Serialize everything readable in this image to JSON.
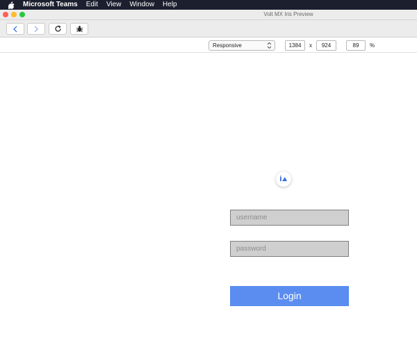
{
  "menubar": {
    "app_name": "Microsoft Teams",
    "items": [
      "Edit",
      "View",
      "Window",
      "Help"
    ]
  },
  "window": {
    "title": "Volt MX Iris Preview"
  },
  "toolbar": {
    "buttons": [
      "back-icon",
      "forward-icon",
      "reload-icon",
      "bug-icon"
    ]
  },
  "devicebar": {
    "mode": "Responsive",
    "width": "1384",
    "separator": "x",
    "height": "924",
    "zoom": "89",
    "zoom_unit": "%"
  },
  "login_form": {
    "username_placeholder": "username",
    "password_placeholder": "password",
    "login_label": "Login"
  },
  "colors": {
    "login_button": "#5a8def",
    "field_background": "#cfcfcf",
    "menubar": "#1c1f2e"
  }
}
